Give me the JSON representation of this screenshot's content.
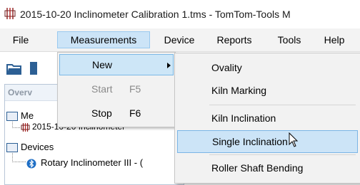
{
  "window": {
    "title": "2015-10-20 Inclinometer Calibration 1.tms - TomTom-Tools M",
    "icon": "device-icon"
  },
  "menubar": {
    "items": [
      {
        "label": "File"
      },
      {
        "label": "Measurements"
      },
      {
        "label": "Device"
      },
      {
        "label": "Reports"
      },
      {
        "label": "Tools"
      },
      {
        "label": "Help"
      }
    ]
  },
  "measurements_menu": {
    "items": [
      {
        "label": "New",
        "shortcut": "",
        "disabled": false,
        "has_submenu": true
      },
      {
        "label": "Start",
        "shortcut": "F5",
        "disabled": true
      },
      {
        "label": "Stop",
        "shortcut": "F6",
        "disabled": false
      }
    ]
  },
  "new_submenu": {
    "items": [
      {
        "label": "Ovality"
      },
      {
        "label": "Kiln Marking"
      },
      {
        "label": "Kiln Inclination"
      },
      {
        "label": "Single Inclination"
      },
      {
        "label": "Roller Shaft Bending"
      }
    ],
    "highlighted": "Single Inclination"
  },
  "overview": {
    "header": "Overv",
    "tree": [
      {
        "label": "Me"
      },
      {
        "label": "2015-10-20 Inclinometer"
      },
      {
        "label": "Devices"
      },
      {
        "label": "Rotary Inclinometer III - ("
      }
    ]
  },
  "colors": {
    "highlight": "#cce4f7",
    "highlight_border": "#7ab5e6",
    "menubar": "#f3f3f3",
    "folder_blue": "#2c5f94"
  }
}
